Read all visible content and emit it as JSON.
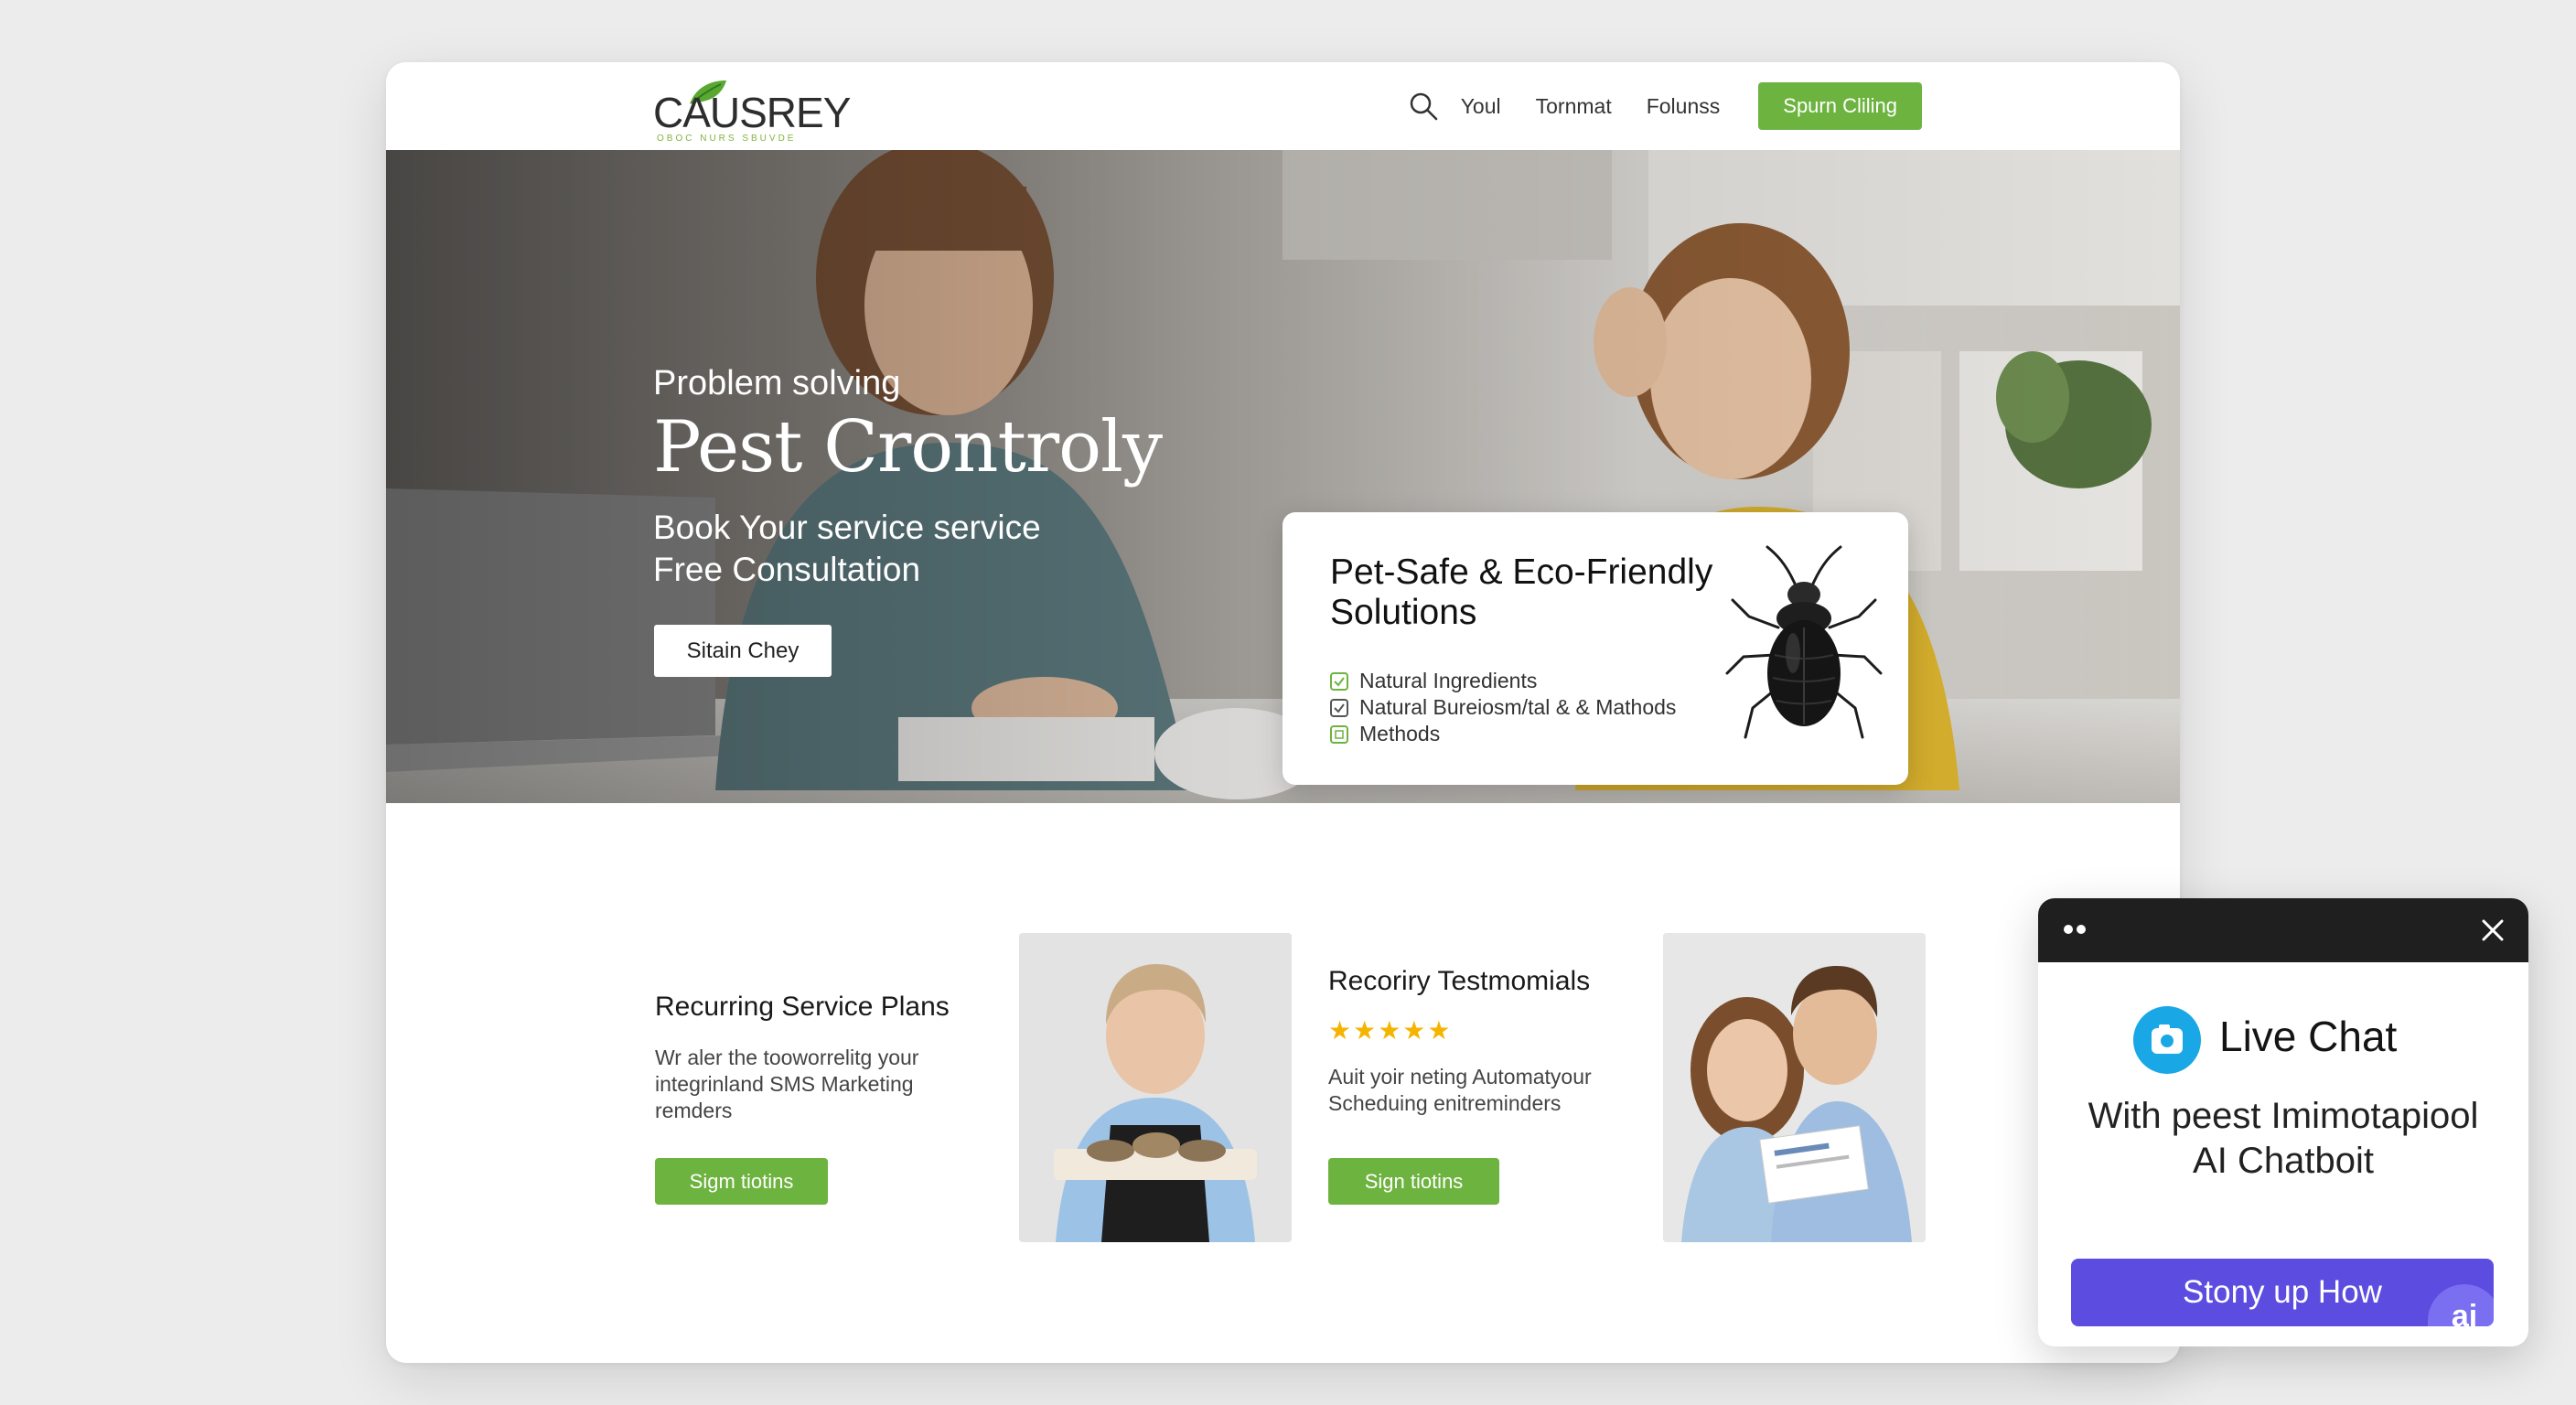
{
  "brand": {
    "name": "CAUSREY",
    "tagline": "OBOC NURS SBUVDE",
    "accent_color": "#6db33f"
  },
  "nav": {
    "search_icon": "search-icon",
    "links": [
      "Youl",
      "Tornmat",
      "Folunss"
    ],
    "cta": "Spurn Cliling"
  },
  "hero": {
    "eyebrow": "Problem solving",
    "title": "Pest Crontroly",
    "subtitle_line1": "Book Your service service",
    "subtitle_line2": "Free Consultation",
    "button": "Sitain Chey"
  },
  "eco_card": {
    "title": "Pet-Safe & Eco-Friendly Solutions",
    "items": [
      "Natural Ingredients",
      "Natural Bureiosm/tal & & Mathods",
      "Methods"
    ],
    "icon": "beetle-icon"
  },
  "features": {
    "plans": {
      "title": "Recurring Service Plans",
      "desc_lines": [
        "Wr aler the tooworrelitg your",
        "integrinland SMS Marketing",
        "remders"
      ],
      "button": "Sigm tiotins"
    },
    "testimonials": {
      "title": "Recoriry Testmomials",
      "rating": 5,
      "stars": "★★★★★",
      "desc_lines": [
        "Auit yoir neting Automatyour",
        "Scheduing enitreminders"
      ],
      "button": "Sign tiotins"
    }
  },
  "chat": {
    "title": "Live Chat",
    "subtitle_line1": "With peest Imimotapiool",
    "subtitle_line2": "AI Chatboit",
    "button": "Stony up How",
    "badge": "ai",
    "brand_color": "#5c4de0"
  }
}
